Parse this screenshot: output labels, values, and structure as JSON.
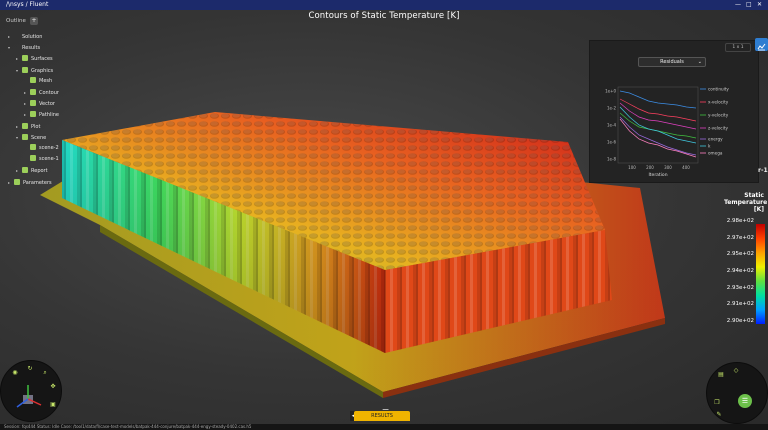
{
  "app": {
    "brand": "/\\nsys",
    "separator": "/",
    "product": "Fluent"
  },
  "window_controls": [
    "—",
    "□",
    "✕"
  ],
  "outline": {
    "title": "Outline",
    "add_button": "+",
    "items": [
      {
        "label": "Solution",
        "level": 0,
        "arrow": "▸",
        "icon": false
      },
      {
        "label": "Results",
        "level": 0,
        "arrow": "▾",
        "icon": false
      },
      {
        "label": "Surfaces",
        "level": 1,
        "arrow": "▸",
        "icon": true
      },
      {
        "label": "Graphics",
        "level": 1,
        "arrow": "▾",
        "icon": true
      },
      {
        "label": "Mesh",
        "level": 2,
        "arrow": "",
        "icon": true
      },
      {
        "label": "Contour",
        "level": 2,
        "arrow": "▸",
        "icon": true
      },
      {
        "label": "Vector",
        "level": 2,
        "arrow": "▸",
        "icon": true
      },
      {
        "label": "Pathline",
        "level": 2,
        "arrow": "▸",
        "icon": true
      },
      {
        "label": "Plot",
        "level": 1,
        "arrow": "▸",
        "icon": true
      },
      {
        "label": "Scene",
        "level": 1,
        "arrow": "▾",
        "icon": true
      },
      {
        "label": "scene-2",
        "level": 2,
        "arrow": "",
        "icon": true
      },
      {
        "label": "scene-1",
        "level": 2,
        "arrow": "",
        "icon": true
      },
      {
        "label": "Report",
        "level": 1,
        "arrow": "▸",
        "icon": true
      },
      {
        "label": "Parameters",
        "level": 0,
        "arrow": "▸",
        "icon": true
      }
    ]
  },
  "viewport": {
    "title": "Contours of Static Temperature  [K]"
  },
  "residuals_panel": {
    "dropdown": "Residuals",
    "layout": "1 x 1",
    "xlabel": "Iteration",
    "cut_label": "r-1",
    "y_ticks": [
      "1e+0",
      "1e-2",
      "1e-4",
      "1e-6",
      "1e-8"
    ],
    "x_ticks": [
      "100",
      "200",
      "300",
      "400"
    ],
    "series": [
      {
        "name": "continuity",
        "color": "#3c8ee6"
      },
      {
        "name": "x-velocity",
        "color": "#ff4060"
      },
      {
        "name": "y-velocity",
        "color": "#40c040"
      },
      {
        "name": "z-velocity",
        "color": "#e040c0"
      },
      {
        "name": "energy",
        "color": "#9a6ae0"
      },
      {
        "name": "k",
        "color": "#40c8e0"
      },
      {
        "name": "omega",
        "color": "#ff80c0"
      }
    ]
  },
  "legend": {
    "title": "Static Temperature",
    "unit": "[K]",
    "ticks": [
      "2.98e+02",
      "2.97e+02",
      "2.95e+02",
      "2.94e+02",
      "2.93e+02",
      "2.91e+02",
      "2.90e+02"
    ]
  },
  "bottom": {
    "results_tab": "RESULTS",
    "left_arrow": "◂",
    "menu": "☰"
  },
  "status": {
    "text": "Session: fqs444   Status: Idle   Case: /tool1/data/fl/case-test-models/batpak-444-conjure/batpak-444-engy-steady-0402.cas.h5"
  },
  "colors": {
    "titlebar": "#1c2a6b",
    "accent": "#f0b400",
    "triad_green": "#6cc04a"
  }
}
